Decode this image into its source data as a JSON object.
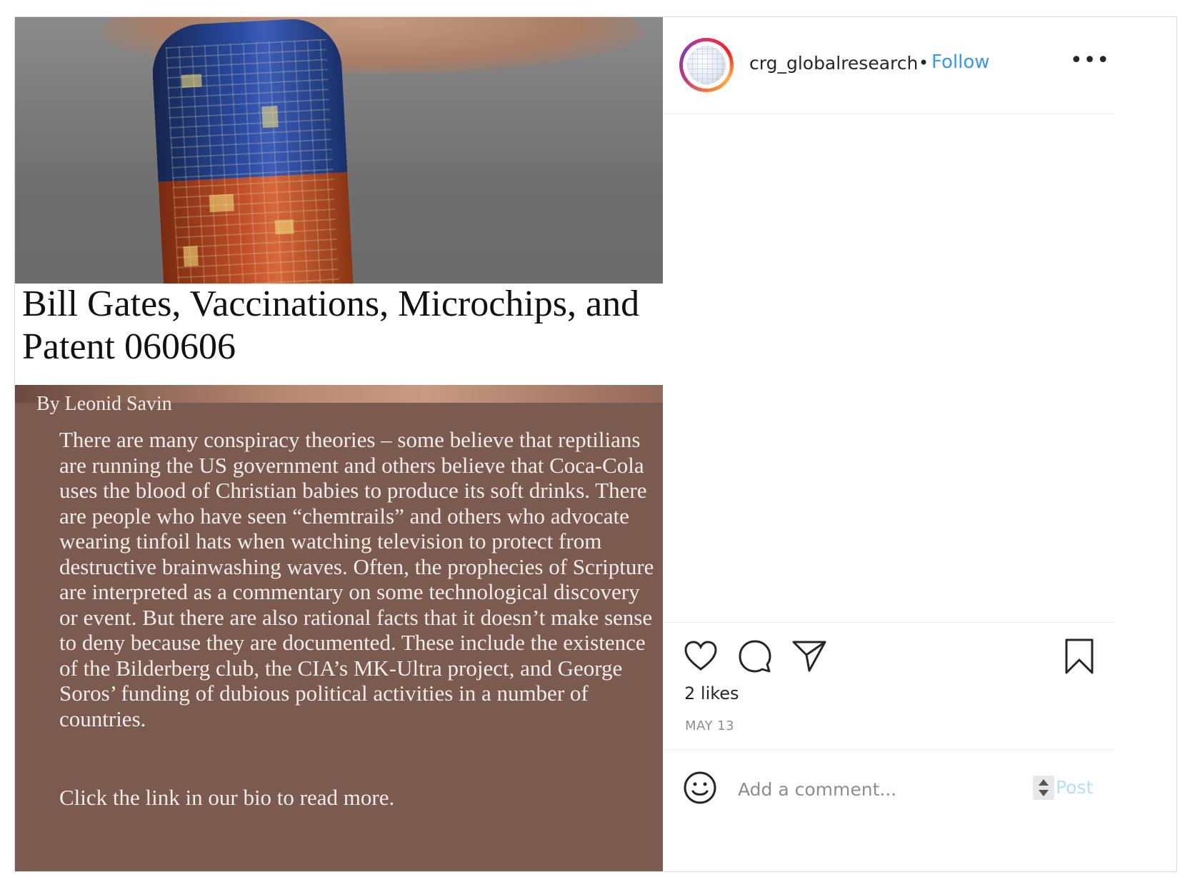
{
  "post": {
    "image": {
      "headline": "Bill Gates, Vaccinations, Microchips, and Patent 060606",
      "byline": "By Leonid Savin",
      "body": "There are many conspiracy theories – some believe that reptilians are running the US government and others believe that Coca-Cola uses the blood of Christian babies to produce its soft drinks. There are people who have seen “chemtrails” and others who advocate wearing tinfoil hats when watching television to protect from destructive brainwashing waves. Often, the prophecies of Scripture are interpreted as a commentary on some technological discovery or event. But there are also rational facts that it doesn’t make sense to deny because they are documented. These include the existence of the Bilderberg club, the CIA’s MK-Ultra project, and George Soros’ funding of dubious political activities in a number of countries.",
      "cta": "Click the link in our bio to read more."
    },
    "header": {
      "username": "crg_globalresearch",
      "separator": "•",
      "follow_label": "Follow",
      "more_label": "•••"
    },
    "actions": {
      "like_icon": "heart-icon",
      "comment_icon": "speech-bubble-icon",
      "share_icon": "paper-plane-icon",
      "save_icon": "bookmark-icon",
      "likes": "2 likes",
      "date": "MAY 13"
    },
    "comment": {
      "emoji_icon": "smiley-icon",
      "placeholder": "Add a comment...",
      "post_label": "Post"
    },
    "colors": {
      "accent": "#3897f0",
      "post_disabled": "#b2dffc",
      "image_background": "#7b5a50"
    }
  }
}
